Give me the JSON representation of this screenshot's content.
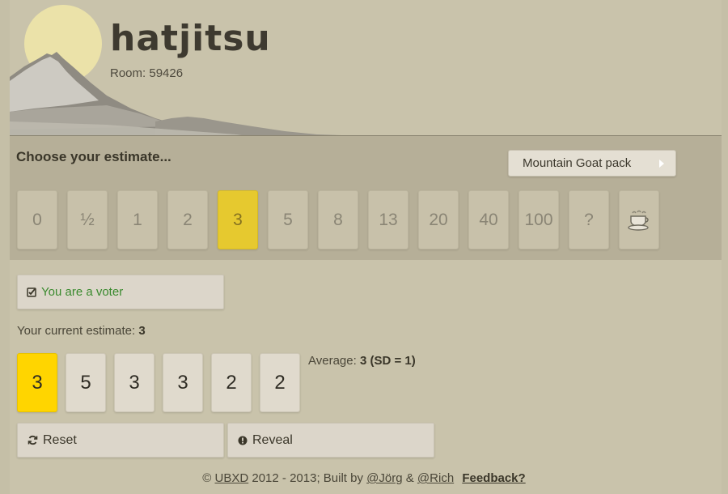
{
  "header": {
    "brand": "hatjitsu",
    "room_label": "Room: 59426"
  },
  "estimate": {
    "title": "Choose your estimate...",
    "pack_button": "Mountain Goat pack",
    "cards": [
      "0",
      "½",
      "1",
      "2",
      "3",
      "5",
      "8",
      "13",
      "20",
      "40",
      "100",
      "?"
    ],
    "coffee_card_icon": "coffee-cup-icon",
    "selected": "3"
  },
  "voter": {
    "status": "You are a voter"
  },
  "current": {
    "label": "Your current estimate:",
    "value": "3"
  },
  "votes": [
    "3",
    "5",
    "3",
    "3",
    "2",
    "2"
  ],
  "average": {
    "label": "Average:",
    "value": "3 (SD = 1)"
  },
  "actions": {
    "reset": "Reset",
    "reveal": "Reveal"
  },
  "footer": {
    "copyright": "©",
    "ubxd": "UBXD",
    "years": "2012 - 2013; Built by",
    "jorg": "@Jörg",
    "amp": "&",
    "rich": "@Rich",
    "feedback": "Feedback?"
  },
  "colors": {
    "selected_card": "#e6c92f",
    "my_vote": "#ffd500",
    "voter_text": "#3a8a2e",
    "background": "#c5bfa7"
  }
}
